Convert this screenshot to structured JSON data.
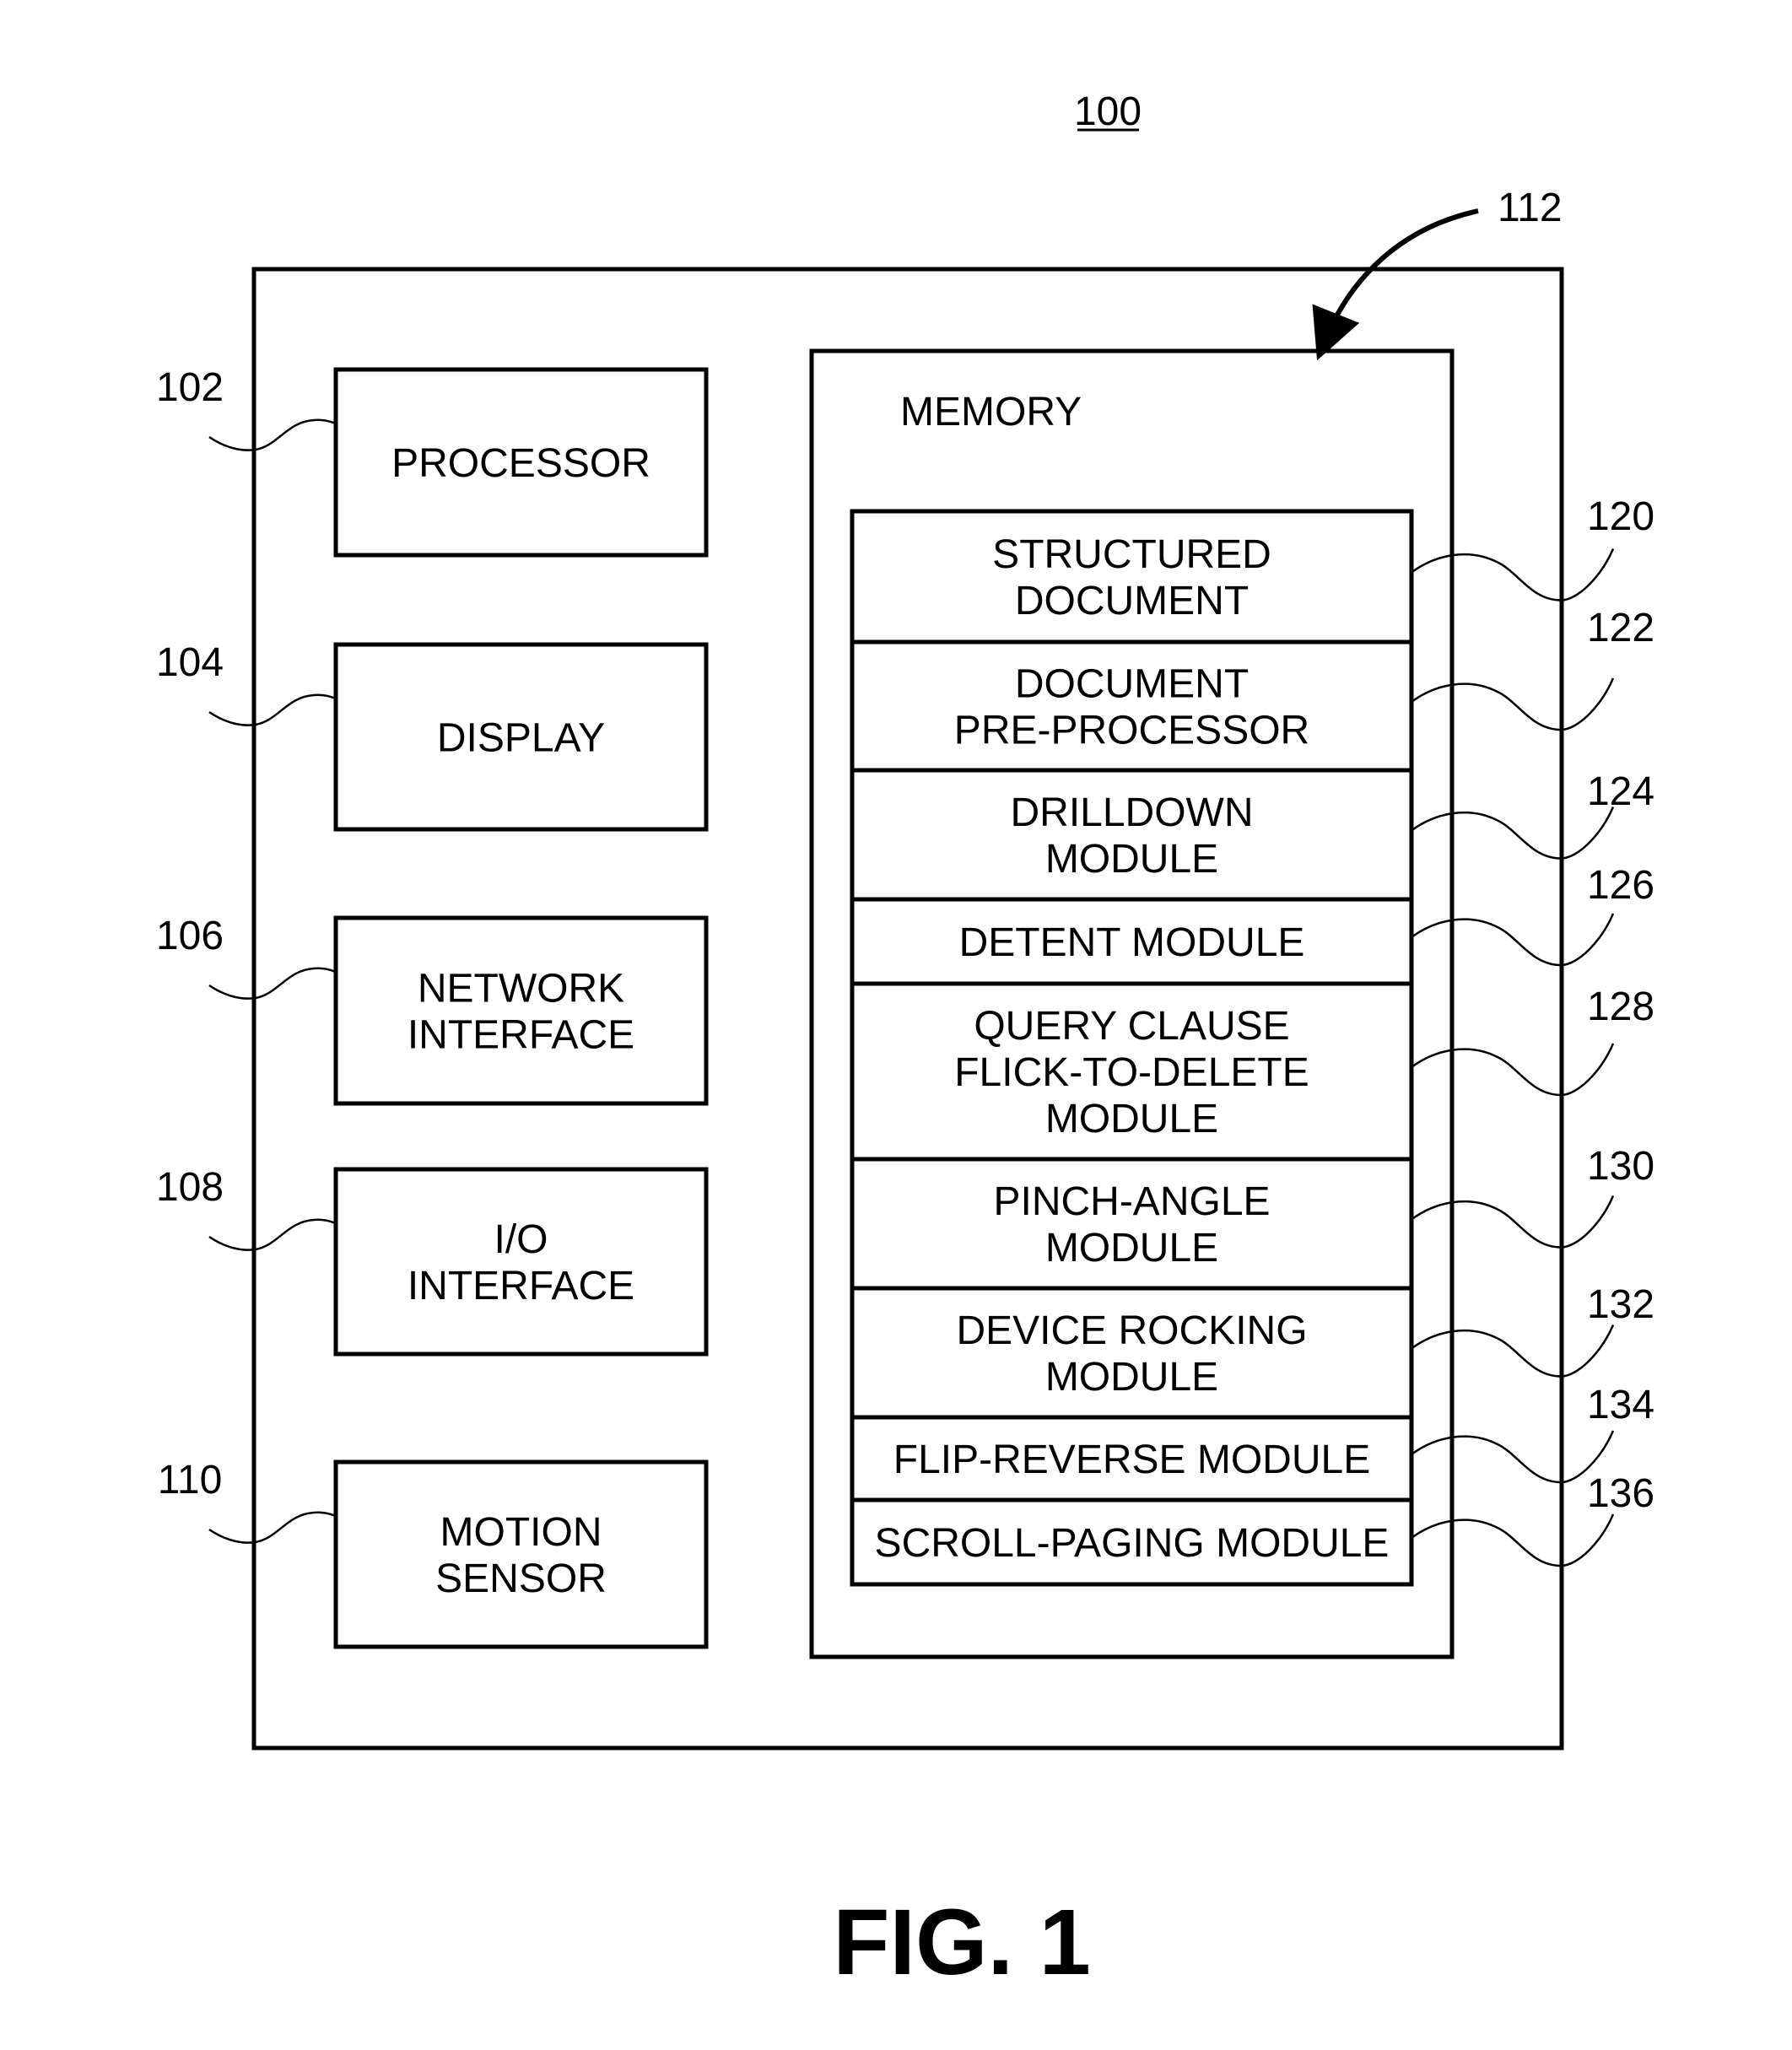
{
  "figure": {
    "label": "FIG. 1",
    "system_ref": "100",
    "memory_arrow_ref": "112"
  },
  "components": [
    {
      "ref": "102",
      "lines": [
        "PROCESSOR"
      ]
    },
    {
      "ref": "104",
      "lines": [
        "DISPLAY"
      ]
    },
    {
      "ref": "106",
      "lines": [
        "NETWORK",
        "INTERFACE"
      ]
    },
    {
      "ref": "108",
      "lines": [
        "I/O",
        "INTERFACE"
      ]
    },
    {
      "ref": "110",
      "lines": [
        "MOTION",
        "SENSOR"
      ]
    }
  ],
  "memory": {
    "title": "MEMORY",
    "modules": [
      {
        "ref": "120",
        "lines": [
          "STRUCTURED",
          "DOCUMENT"
        ]
      },
      {
        "ref": "122",
        "lines": [
          "DOCUMENT",
          "PRE-PROCESSOR"
        ]
      },
      {
        "ref": "124",
        "lines": [
          "DRILLDOWN",
          "MODULE"
        ]
      },
      {
        "ref": "126",
        "lines": [
          "DETENT MODULE"
        ]
      },
      {
        "ref": "128",
        "lines": [
          "QUERY CLAUSE",
          "FLICK-TO-DELETE",
          "MODULE"
        ]
      },
      {
        "ref": "130",
        "lines": [
          "PINCH-ANGLE",
          "MODULE"
        ]
      },
      {
        "ref": "132",
        "lines": [
          "DEVICE ROCKING",
          "MODULE"
        ]
      },
      {
        "ref": "134",
        "lines": [
          "FLIP-REVERSE MODULE"
        ]
      },
      {
        "ref": "136",
        "lines": [
          "SCROLL-PAGING MODULE"
        ]
      }
    ]
  }
}
